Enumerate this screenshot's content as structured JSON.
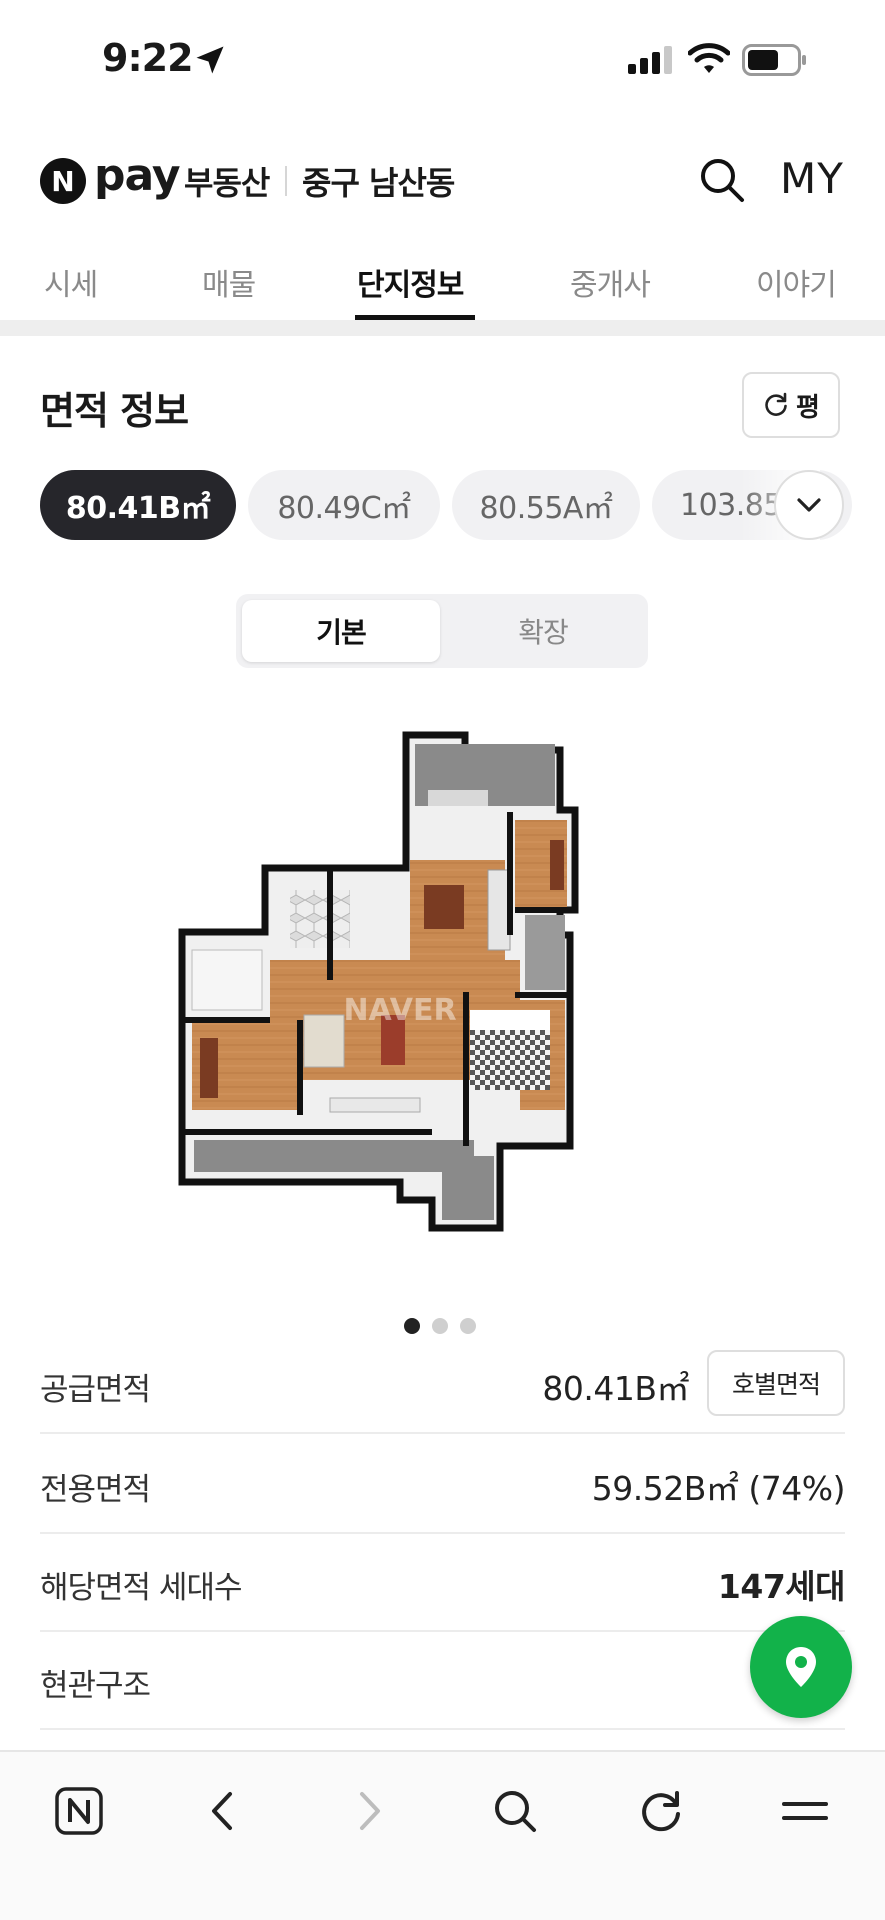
{
  "status_bar": {
    "time": "9:22",
    "icons": [
      "location-arrow-icon",
      "signal-icon",
      "wifi-icon",
      "battery-icon"
    ]
  },
  "header": {
    "brand_logo": "N",
    "brand_pay": "pay",
    "brand_service": "부동산",
    "location": "중구 남산동",
    "search_icon": "search-icon",
    "my_label": "MY"
  },
  "tabs": [
    {
      "label": "시세",
      "active": false
    },
    {
      "label": "매물",
      "active": false
    },
    {
      "label": "단지정보",
      "active": true
    },
    {
      "label": "중개사",
      "active": false
    },
    {
      "label": "이야기",
      "active": false
    }
  ],
  "area_section": {
    "title": "면적 정보",
    "unit_toggle_label": "평",
    "unit_toggle_icon": "refresh-icon",
    "area_chips": [
      {
        "label": "80.41B㎡",
        "active": true
      },
      {
        "label": "80.49C㎡",
        "active": false
      },
      {
        "label": "80.55A㎡",
        "active": false
      },
      {
        "label": "103.85",
        "active": false
      }
    ],
    "expand_icon": "chevron-down-icon",
    "view_modes": [
      {
        "label": "기본",
        "active": true
      },
      {
        "label": "확장",
        "active": false
      }
    ],
    "floorplan_watermark": "NAVER",
    "carousel": {
      "count": 3,
      "active_index": 0
    }
  },
  "info_rows": [
    {
      "label": "공급면적",
      "value": "80.41B㎡",
      "button": "호별면적"
    },
    {
      "label": "전용면적",
      "value": "59.52B㎡ (74%)"
    },
    {
      "label": "해당면적 세대수",
      "value": "147세대"
    },
    {
      "label": "현관구조",
      "value": ""
    }
  ],
  "map_button_icon": "map-pin-icon",
  "browser_bar": {
    "icons": [
      "naver-home-icon",
      "back-icon",
      "forward-icon",
      "search-icon",
      "reload-icon",
      "menu-icon"
    ]
  },
  "colors": {
    "accent_green": "#12b24a",
    "active_chip": "#26262b",
    "text_primary": "#1a1a1a",
    "text_muted": "#8a8a8a"
  }
}
